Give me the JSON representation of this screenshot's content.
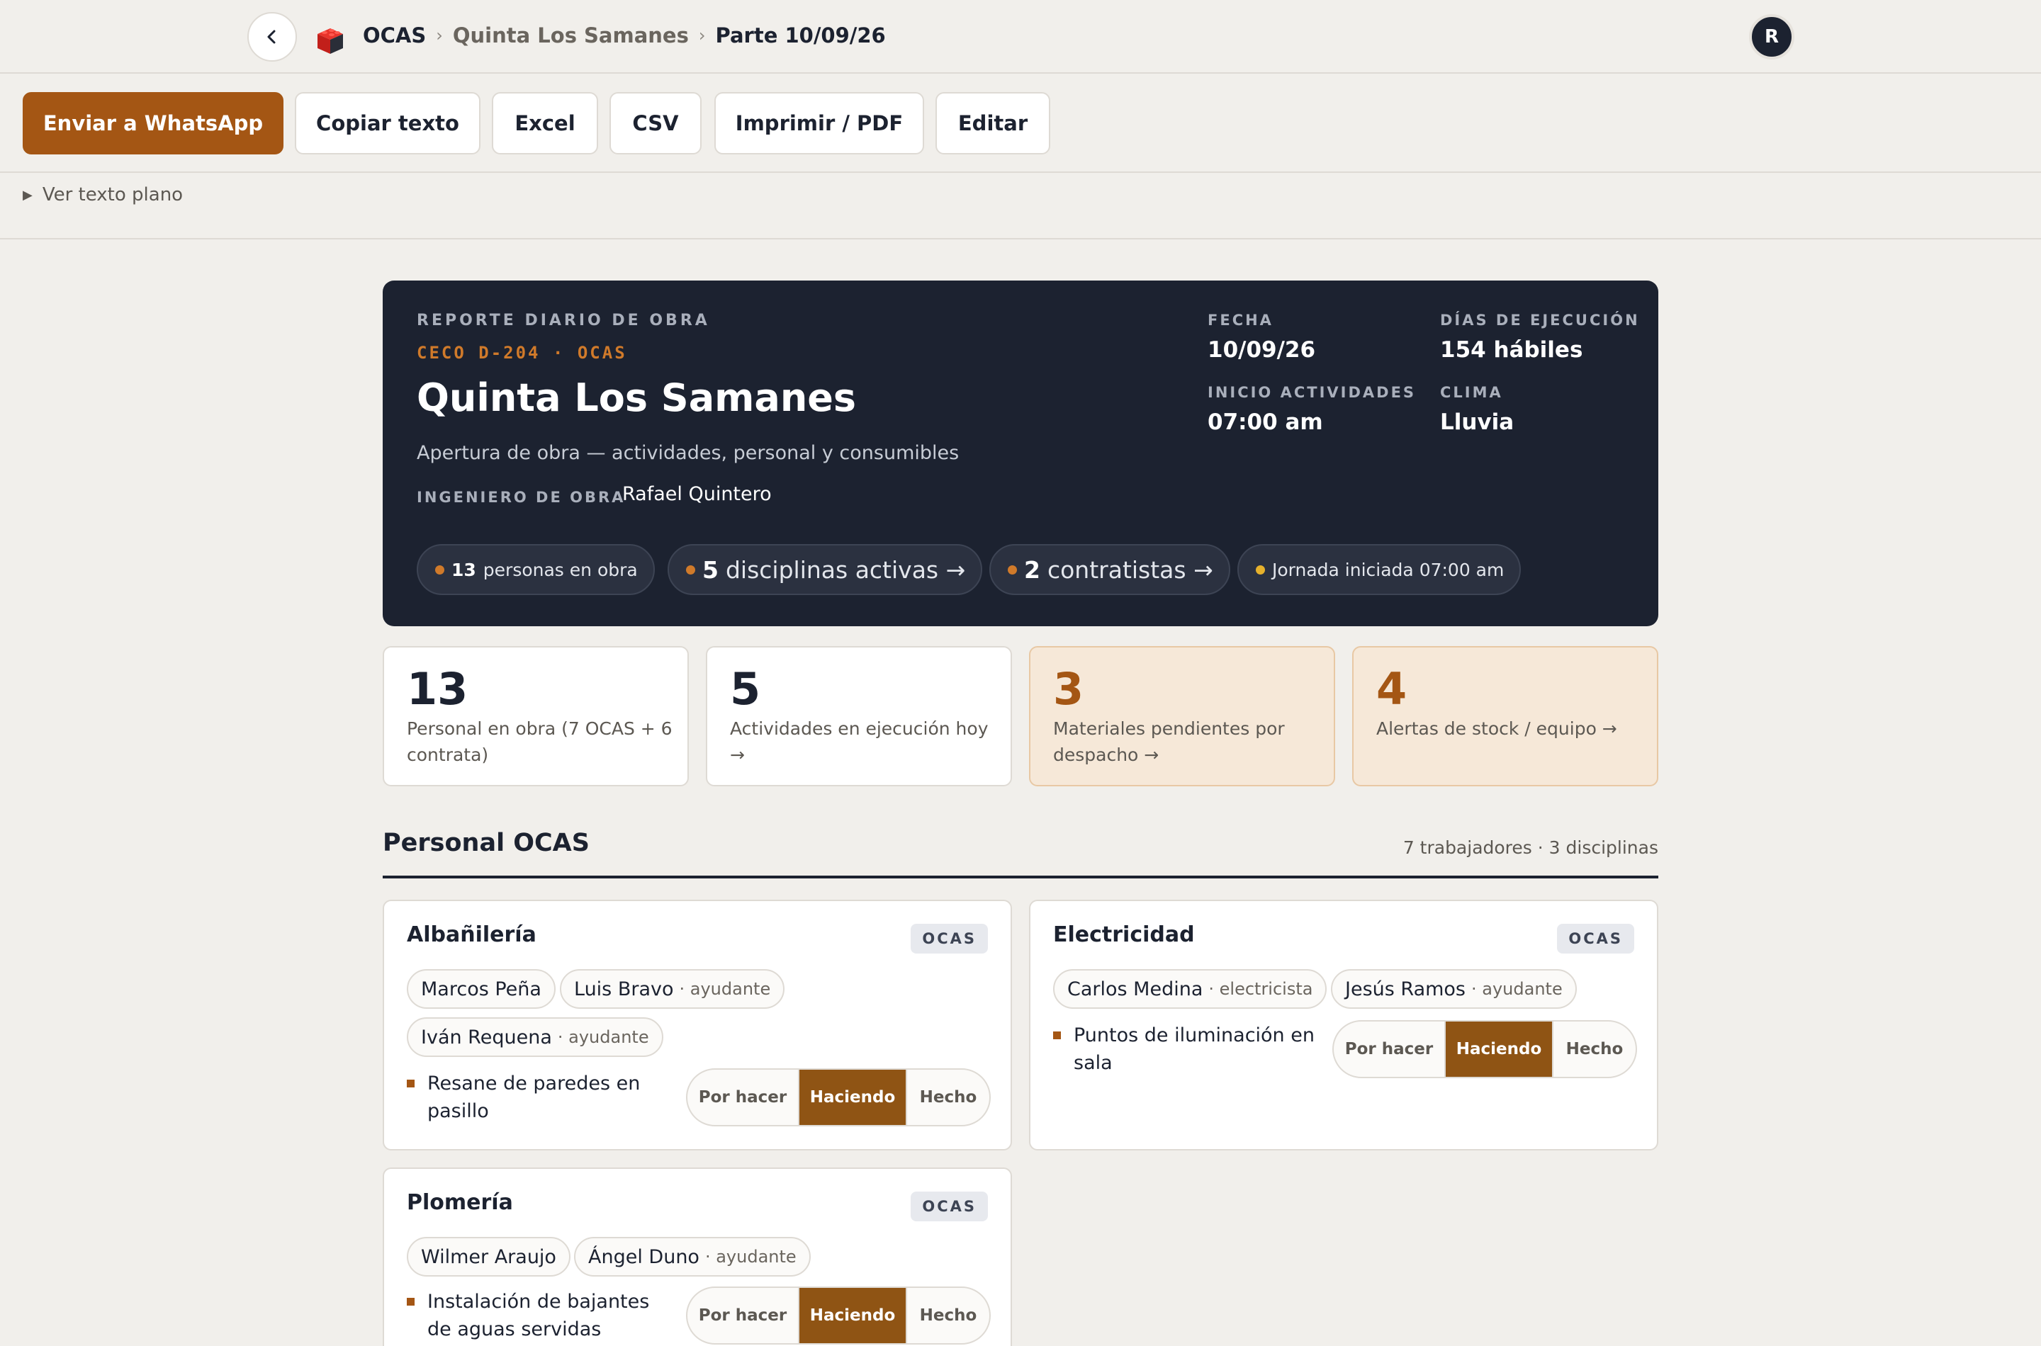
{
  "topbar": {
    "back_icon": "chevron-left-icon",
    "logo_icon": "brick-logo-icon",
    "breadcrumb": {
      "root": "OCAS",
      "project": "Quinta Los Samanes",
      "current": "Parte 10/09/26"
    },
    "avatar_initial": "R"
  },
  "toolbar": {
    "whatsapp": "Enviar a WhatsApp",
    "copy": "Copiar texto",
    "excel": "Excel",
    "csv": "CSV",
    "print": "Imprimir / PDF",
    "edit": "Editar",
    "plain_text": "Ver texto plano"
  },
  "hero": {
    "eyebrow": "REPORTE DIARIO DE OBRA",
    "ceco": "CECO D-204 · OCAS",
    "title": "Quinta Los Samanes",
    "subtitle": "Apertura de obra — actividades, personal y consumibles",
    "engineer_label": "INGENIERO DE OBRA",
    "engineer_name": "Rafael Quintero",
    "meta": {
      "fecha_label": "FECHA",
      "fecha": "10/09/26",
      "dias_label": "DÍAS DE EJECUCIÓN",
      "dias": "154 hábiles",
      "inicio_label": "INICIO ACTIVIDADES",
      "inicio": "07:00 am",
      "clima_label": "CLIMA",
      "clima": "Lluvia"
    },
    "pills": [
      {
        "num": "13",
        "text": "personas en obra"
      },
      {
        "num": "5",
        "text": "disciplinas activas →"
      },
      {
        "num": "2",
        "text": "contratistas →"
      },
      {
        "num": "",
        "text": "Jornada iniciada 07:00 am"
      }
    ],
    "accent_color": "#d07a2a"
  },
  "stats": [
    {
      "value": "13",
      "label": "Personal en obra (7 OCAS + 6 contrata)"
    },
    {
      "value": "5",
      "label": "Actividades en ejecución hoy →"
    },
    {
      "value": "3",
      "label": "Materiales pendientes por despacho →"
    },
    {
      "value": "4",
      "label": "Alertas de stock / equipo →"
    }
  ],
  "section": {
    "title": "Personal OCAS",
    "meta": "7 trabajadores · 3 disciplinas"
  },
  "status_options": [
    "Por hacer",
    "Haciendo",
    "Hecho"
  ],
  "disciplines": [
    {
      "name": "Albañilería",
      "tag": "OCAS",
      "workers": [
        {
          "name": "Marcos Peña",
          "role": ""
        },
        {
          "name": "Luis Bravo",
          "role": "· ayudante"
        },
        {
          "name": "Iván Requena",
          "role": "· ayudante"
        }
      ],
      "activity": "Resane de paredes en pasillo",
      "status": "Haciendo"
    },
    {
      "name": "Electricidad",
      "tag": "OCAS",
      "workers": [
        {
          "name": "Carlos Medina",
          "role": "· electricista"
        },
        {
          "name": "Jesús Ramos",
          "role": "· ayudante"
        }
      ],
      "activity": "Puntos de iluminación en sala",
      "status": "Haciendo"
    },
    {
      "name": "Plomería",
      "tag": "OCAS",
      "workers": [
        {
          "name": "Wilmer Araujo",
          "role": ""
        },
        {
          "name": "Ángel Duno",
          "role": "· ayudante"
        }
      ],
      "activity": "Instalación de bajantes de aguas servidas",
      "status": "Haciendo"
    }
  ],
  "colors": {
    "brand": "#a45614",
    "navy": "#1c2230",
    "active_status": "#8f5414"
  }
}
